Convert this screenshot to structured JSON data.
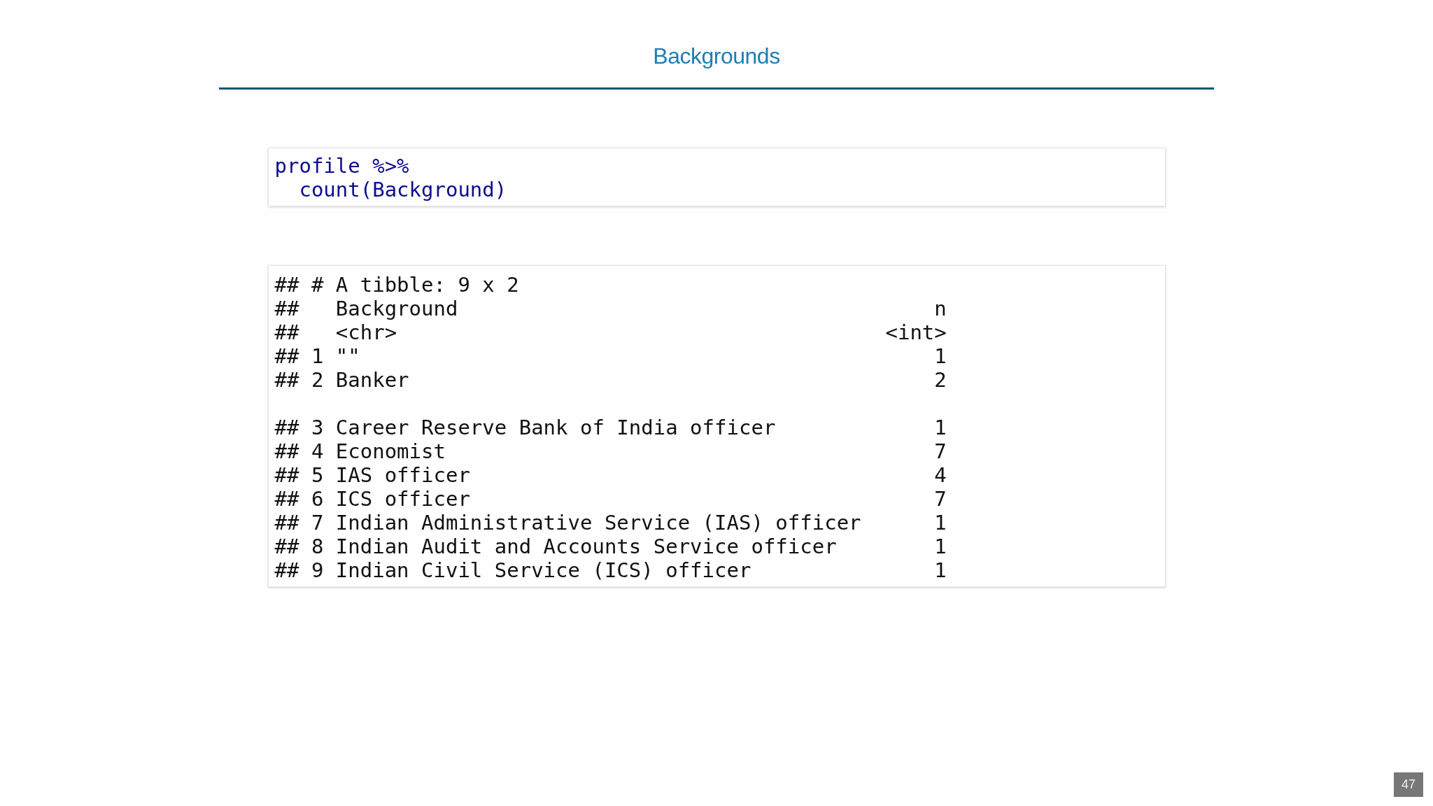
{
  "slide": {
    "title": "Backgrounds",
    "page_number": "47"
  },
  "code": {
    "lines": [
      "profile %>%",
      "  count(Background)"
    ]
  },
  "output": {
    "blocks": [
      {
        "lines": [
          "## # A tibble: 9 x 2",
          "##   Background                                       n",
          "##   <chr>                                        <int>",
          "## 1 \"\"                                               1",
          "## 2 Banker                                           2"
        ]
      },
      {
        "lines": [
          "## 3 Career Reserve Bank of India officer             1",
          "## 4 Economist                                        7",
          "## 5 IAS officer                                      4",
          "## 6 ICS officer                                      7",
          "## 7 Indian Administrative Service (IAS) officer      1",
          "## 8 Indian Audit and Accounts Service officer        1",
          "## 9 Indian Civil Service (ICS) officer               1"
        ]
      }
    ]
  }
}
